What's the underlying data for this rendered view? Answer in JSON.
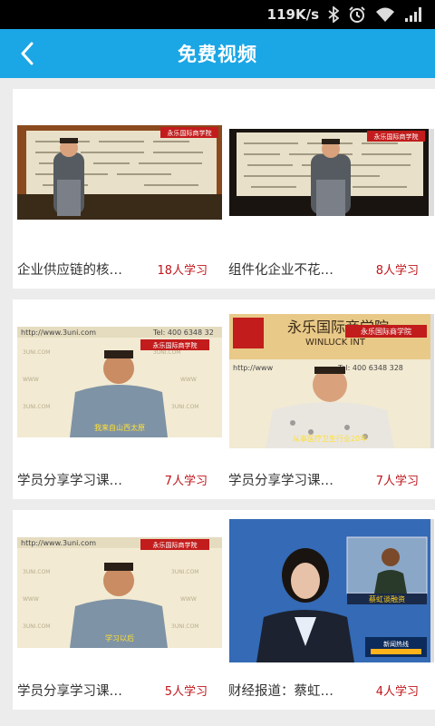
{
  "colors": {
    "accent": "#1ba6e5",
    "count": "#c0161b",
    "status_bar": "#000000"
  },
  "status_bar": {
    "net_speed": "119K/s",
    "icons": [
      "bluetooth-icon",
      "alarm-icon",
      "wifi-icon",
      "signal-icon"
    ]
  },
  "header": {
    "title": "免费视频",
    "back_icon": "chevron-left-icon"
  },
  "videos": [
    {
      "title": "企业供应链的核…",
      "learners": "18人学习",
      "thumb": {
        "banner": "永乐国际商学院"
      }
    },
    {
      "title": "组件化企业不花…",
      "learners": "8人学习",
      "thumb": {
        "banner": "永乐国际商学院"
      }
    },
    {
      "title": "学员分享学习课…",
      "learners": "7人学习",
      "thumb": {
        "url_text": "http://www.3uni.com",
        "phone": "Tel: 400 6348 32",
        "banner": "永乐国际商学院",
        "caption": "我来自山西太原"
      }
    },
    {
      "title": "学员分享学习课…",
      "learners": "7人学习",
      "thumb": {
        "brand_cn": "永乐国际商学院",
        "brand_en": "WINLUCK INT",
        "url_text": "http://www",
        "phone": "Tel: 400 6348 328",
        "banner": "永乐国际商学院",
        "caption": "从事医疗卫生行业20年"
      }
    },
    {
      "title": "学员分享学习课…",
      "learners": "5人学习",
      "thumb": {
        "url_text": "http://www.3uni.com",
        "banner": "永乐国际商学院",
        "caption": "学习以后"
      }
    },
    {
      "title": "财经报道：蔡虹…",
      "learners": "4人学习",
      "thumb": {
        "inset_caption": "蔡虹谈融资",
        "ticker": "新闻热线"
      }
    }
  ]
}
